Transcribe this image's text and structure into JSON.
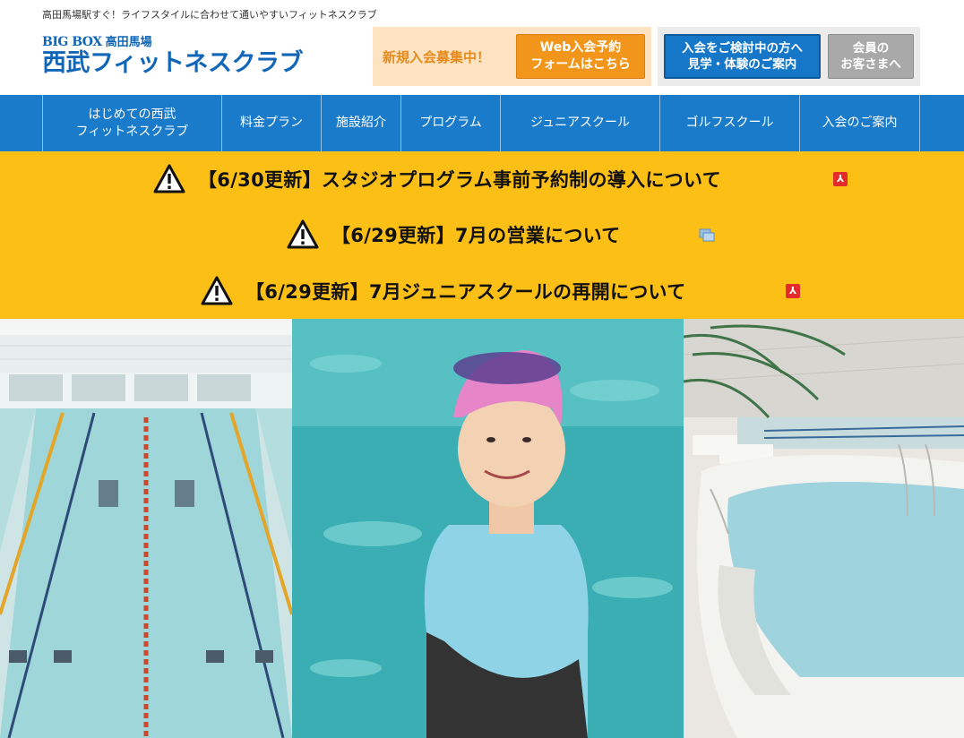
{
  "header": {
    "tagline": "高田馬場駅すぐ！ライフスタイルに合わせて通いやすいフィットネスクラブ",
    "logo_sub_brand": "BIG BOX",
    "logo_sub_location": "高田馬場",
    "logo_main": "西武フィットネスクラブ",
    "recruit_text": "新規入会募集中！",
    "web_btn_line1": "Web入会予約",
    "web_btn_line2": "フォームはこちら",
    "visit_btn_line1": "入会をご検討中の方へ",
    "visit_btn_line2": "見学・体験のご案内",
    "member_btn_line1": "会員の",
    "member_btn_line2": "お客さまへ"
  },
  "nav": {
    "items": [
      {
        "line1": "はじめての西武",
        "line2": "フィットネスクラブ"
      },
      {
        "line1": "料金プラン"
      },
      {
        "line1": "施設紹介"
      },
      {
        "line1": "プログラム"
      },
      {
        "line1": "ジュニアスクール"
      },
      {
        "line1": "ゴルフスクール"
      },
      {
        "line1": "入会のご案内"
      }
    ]
  },
  "notices": [
    {
      "text": "【6/30更新】スタジオプログラム事前予約制の導入について",
      "attachment_icon": "pdf-icon"
    },
    {
      "text": "【6/29更新】7月の営業について",
      "attachment_icon": "window-icon"
    },
    {
      "text": "【6/29更新】7月ジュニアスクールの再開について",
      "attachment_icon": "pdf-icon"
    }
  ],
  "colors": {
    "brand_blue": "#1166b8",
    "nav_blue": "#1a7bcb",
    "notice_yellow": "#fbbf16",
    "recruit_bg": "#fde3c2",
    "orange": "#f2961b",
    "member_gray": "#a9a9a9"
  }
}
